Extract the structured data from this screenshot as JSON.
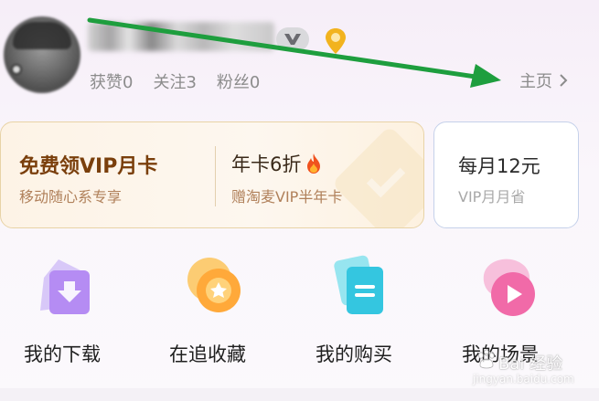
{
  "profile": {
    "stats": [
      {
        "label": "获赞0"
      },
      {
        "label": "关注3"
      },
      {
        "label": "粉丝0"
      }
    ],
    "homepage_link": "主页"
  },
  "vip": {
    "left_title": "免费领VIP月卡",
    "left_subtitle": "移动随心系专享",
    "right_title": "年卡6折",
    "right_subtitle": "赠淘麦VIP半年卡"
  },
  "monthly": {
    "title": "每月12元",
    "subtitle": "VIP月月省"
  },
  "entries": [
    {
      "label": "我的下载",
      "icon": "download-icon"
    },
    {
      "label": "在追收藏",
      "icon": "star-icon"
    },
    {
      "label": "我的购买",
      "icon": "purchase-icon"
    },
    {
      "label": "我的场景",
      "icon": "play-icon"
    }
  ],
  "watermark": {
    "text": "Bai 经验",
    "url": "jingyan.baidu.com"
  },
  "colors": {
    "annotation_arrow": "#1e9e3e",
    "vip_border": "#e8d3a6",
    "monthly_border": "#c5d1ea"
  }
}
